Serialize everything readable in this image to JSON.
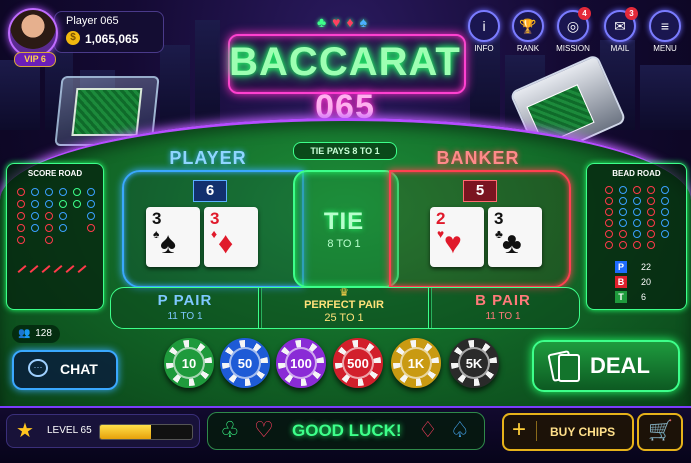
{
  "player": {
    "name": "Player 065",
    "balance": "1,065,065",
    "vip": "VIP 6"
  },
  "title": {
    "line1": "BACCARAT",
    "line2": "065"
  },
  "top_nav": [
    {
      "label": "INFO",
      "icon": "info-icon",
      "glyph": "i"
    },
    {
      "label": "RANK",
      "icon": "trophy-icon",
      "glyph": "🏆"
    },
    {
      "label": "MISSION",
      "icon": "target-icon",
      "glyph": "◎",
      "badge": "4"
    },
    {
      "label": "MAIL",
      "icon": "mail-icon",
      "glyph": "✉",
      "badge": "3"
    },
    {
      "label": "MENU",
      "icon": "menu-icon",
      "glyph": "≡"
    }
  ],
  "table": {
    "tie_pays": "TIE PAYS 8 TO 1",
    "player_label": "PLAYER",
    "player_score": "6",
    "banker_label": "BANKER",
    "banker_score": "5",
    "tie_label": "TIE",
    "tie_odds": "8 TO 1",
    "p_pair_label": "P PAIR",
    "p_pair_odds": "11 TO 1",
    "perfect_pair_label": "PERFECT PAIR",
    "perfect_pair_odds": "25 TO 1",
    "b_pair_label": "B PAIR",
    "b_pair_odds": "11 TO 1",
    "player_cards": [
      {
        "rank": "3",
        "suit": "♠",
        "color": "black"
      },
      {
        "rank": "3",
        "suit": "♦",
        "color": "red"
      }
    ],
    "banker_cards": [
      {
        "rank": "2",
        "suit": "♥",
        "color": "red"
      },
      {
        "rank": "3",
        "suit": "♣",
        "color": "black"
      }
    ]
  },
  "score_road": {
    "title": "SCORE ROAD"
  },
  "bead_road": {
    "title": "BEAD ROAD",
    "stats": [
      {
        "key": "P",
        "value": "22",
        "color": "#1e6bff"
      },
      {
        "key": "B",
        "value": "20",
        "color": "#e0202c"
      },
      {
        "key": "T",
        "value": "6",
        "color": "#1f9a3c"
      }
    ]
  },
  "online_count": "128",
  "chat_label": "CHAT",
  "chips": [
    {
      "label": "10",
      "color": "#1f9a3c"
    },
    {
      "label": "50",
      "color": "#1e5bd6"
    },
    {
      "label": "100",
      "color": "#8a2bd6"
    },
    {
      "label": "500",
      "color": "#d21f2c"
    },
    {
      "label": "1K",
      "color": "#c99a12"
    },
    {
      "label": "5K",
      "color": "#2a2a2a"
    }
  ],
  "deal_label": "DEAL",
  "level": {
    "label": "LEVEL 65",
    "progress": 0.55
  },
  "good_luck": "GOOD LUCK!",
  "buy_chips": "BUY CHIPS"
}
